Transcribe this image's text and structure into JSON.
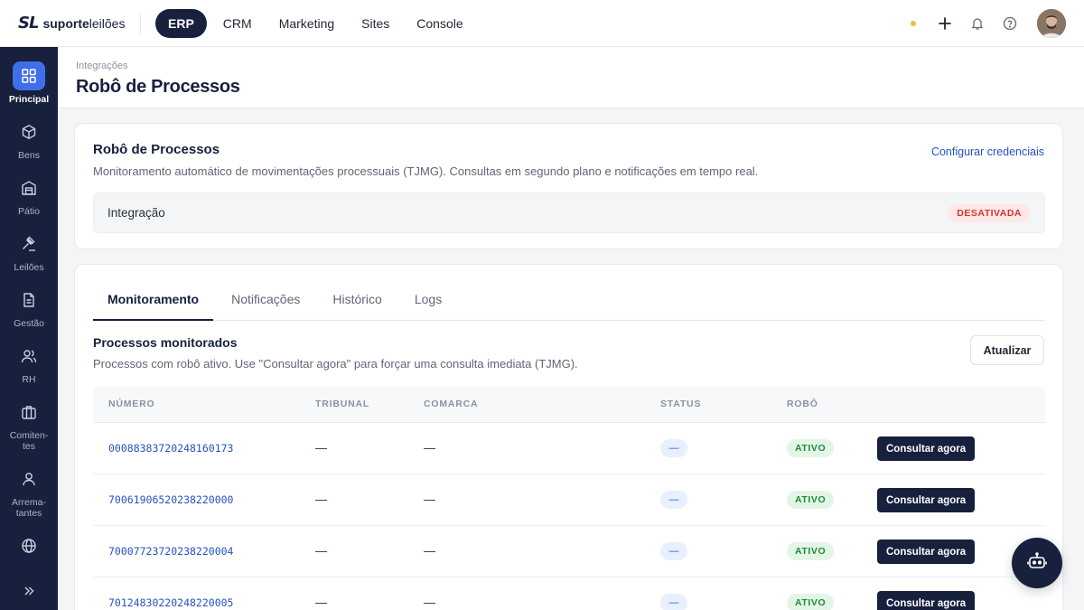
{
  "brand": {
    "mark": "SL",
    "name_bold": "suporte",
    "name_light": "leilões"
  },
  "topnav": [
    {
      "label": "ERP",
      "active": true
    },
    {
      "label": "CRM",
      "active": false
    },
    {
      "label": "Marketing",
      "active": false
    },
    {
      "label": "Sites",
      "active": false
    },
    {
      "label": "Console",
      "active": false
    }
  ],
  "topbar_icons": [
    "status-dot",
    "plus-icon",
    "bell-icon",
    "help-icon",
    "avatar"
  ],
  "sidebar": {
    "items": [
      {
        "label": "Principal",
        "icon": "grid-icon",
        "active": true
      },
      {
        "label": "Bens",
        "icon": "box-icon"
      },
      {
        "label": "Pátio",
        "icon": "warehouse-icon"
      },
      {
        "label": "Leilões",
        "icon": "gavel-icon"
      },
      {
        "label": "Gestão",
        "icon": "document-icon"
      },
      {
        "label": "RH",
        "icon": "users-icon"
      },
      {
        "label": "Comiten-tes",
        "line1": "Comiten-",
        "line2": "tes",
        "icon": "briefcase-icon"
      },
      {
        "label": "Arrema-tantes",
        "line1": "Arrema-",
        "line2": "tantes",
        "icon": "user-icon"
      },
      {
        "label": "",
        "icon": "globe-icon"
      }
    ],
    "expand_icon": "chevrons-right-icon"
  },
  "page": {
    "breadcrumb": "Integrações",
    "title": "Robô de Processos"
  },
  "integration_card": {
    "title": "Robô de Processos",
    "description": "Monitoramento automático de movimentações processuais (TJMG). Consultas em segundo plano e notificações em tempo real.",
    "configure_link": "Configurar credenciais",
    "row_label": "Integração",
    "status_badge": "DESATIVADA"
  },
  "tabs": [
    {
      "label": "Monitoramento",
      "active": true
    },
    {
      "label": "Notificações",
      "active": false
    },
    {
      "label": "Histórico",
      "active": false
    },
    {
      "label": "Logs",
      "active": false
    }
  ],
  "section": {
    "title": "Processos monitorados",
    "description": "Processos com robô ativo. Use \"Consultar agora\" para forçar uma consulta imediata (TJMG).",
    "refresh_button": "Atualizar"
  },
  "table": {
    "columns": [
      "NÚMERO",
      "TRIBUNAL",
      "COMARCA",
      "STATUS",
      "ROBÔ"
    ],
    "rows": [
      {
        "numero": "00088383720248160173",
        "tribunal": "—",
        "comarca": "—",
        "status": "—",
        "robo": "ATIVO",
        "action": "Consultar agora"
      },
      {
        "numero": "70061906520238220000",
        "tribunal": "—",
        "comarca": "—",
        "status": "—",
        "robo": "ATIVO",
        "action": "Consultar agora"
      },
      {
        "numero": "70007723720238220004",
        "tribunal": "—",
        "comarca": "—",
        "status": "—",
        "robo": "ATIVO",
        "action": "Consultar agora"
      },
      {
        "numero": "70124830220248220005",
        "tribunal": "—",
        "comarca": "—",
        "status": "—",
        "robo": "ATIVO",
        "action": "Consultar agora"
      }
    ]
  },
  "fab": {
    "icon": "robot-icon"
  },
  "colors": {
    "navy": "#17203d",
    "accent_blue": "#3f6fe8",
    "link": "#2453c2",
    "danger": "#d2372f",
    "success": "#1f8a3a"
  }
}
